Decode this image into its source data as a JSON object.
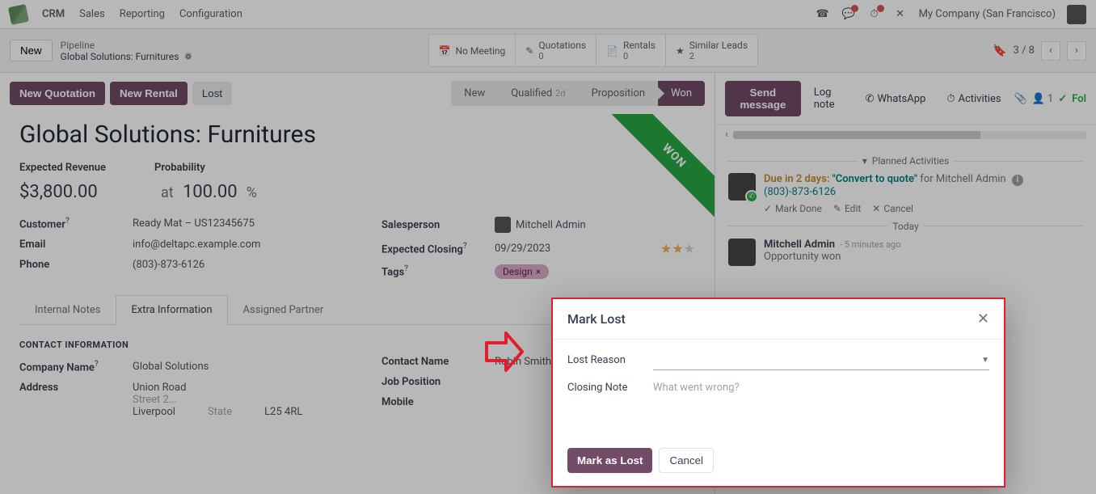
{
  "nav": {
    "brand": "CRM",
    "menus": [
      "Sales",
      "Reporting",
      "Configuration"
    ],
    "company": "My Company (San Francisco)"
  },
  "control": {
    "new": "New",
    "crumb_top": "Pipeline",
    "crumb_bot": "Global Solutions: Furnitures",
    "stats": {
      "meeting": "No Meeting",
      "quotations_label": "Quotations",
      "quotations_count": "0",
      "rentals_label": "Rentals",
      "rentals_count": "0",
      "similar_label": "Similar Leads",
      "similar_count": "2"
    },
    "pager": "3 / 8"
  },
  "actions": {
    "new_quotation": "New Quotation",
    "new_rental": "New Rental",
    "lost": "Lost",
    "stages": {
      "new": "New",
      "qualified": "Qualified",
      "qualified_age": "2d",
      "proposition": "Proposition",
      "won": "Won"
    }
  },
  "record": {
    "title": "Global Solutions: Furnitures",
    "ribbon": "WON",
    "expected_revenue_label": "Expected Revenue",
    "expected_revenue": "$3,800.00",
    "at": "at",
    "probability_label": "Probability",
    "probability": "100.00",
    "pct": "%",
    "customer_label": "Customer",
    "customer": "Ready Mat – US12345675",
    "email_label": "Email",
    "email": "info@deltapc.example.com",
    "phone_label": "Phone",
    "phone": "(803)-873-6126",
    "salesperson_label": "Salesperson",
    "salesperson": "Mitchell Admin",
    "expected_closing_label": "Expected Closing",
    "expected_closing": "09/29/2023",
    "tags_label": "Tags",
    "tag": "Design",
    "tabs": [
      "Internal Notes",
      "Extra Information",
      "Assigned Partner"
    ],
    "contact_section": "CONTACT INFORMATION",
    "company_name_label": "Company Name",
    "company_name": "Global Solutions",
    "address_label": "Address",
    "address_street": "Union Road",
    "address_street2": "Street 2...",
    "address_city": "Liverpool",
    "address_state": "State",
    "address_zip": "L25 4RL",
    "contact_name_label": "Contact Name",
    "contact_name": "Robin Smith",
    "job_label": "Job Position",
    "mobile_label": "Mobile"
  },
  "chatter": {
    "send": "Send message",
    "log": "Log note",
    "whatsapp": "WhatsApp",
    "activities": "Activities",
    "follow_count": "1",
    "follow": "Fol",
    "planned": "Planned Activities",
    "act_due": "Due in 2 days:",
    "act_quote": "\"Convert to quote\"",
    "act_for": "for Mitchell Admin",
    "act_phone": "(803)-873-6126",
    "mark_done": "Mark Done",
    "edit": "Edit",
    "cancel": "Cancel",
    "today": "Today",
    "msg_who": "Mitchell Admin",
    "msg_when": "- 5 minutes ago",
    "msg_txt": "Opportunity won"
  },
  "modal": {
    "title": "Mark Lost",
    "lost_reason": "Lost Reason",
    "closing_note": "Closing Note",
    "placeholder": "What went wrong?",
    "mark_lost": "Mark as Lost",
    "cancel": "Cancel"
  }
}
